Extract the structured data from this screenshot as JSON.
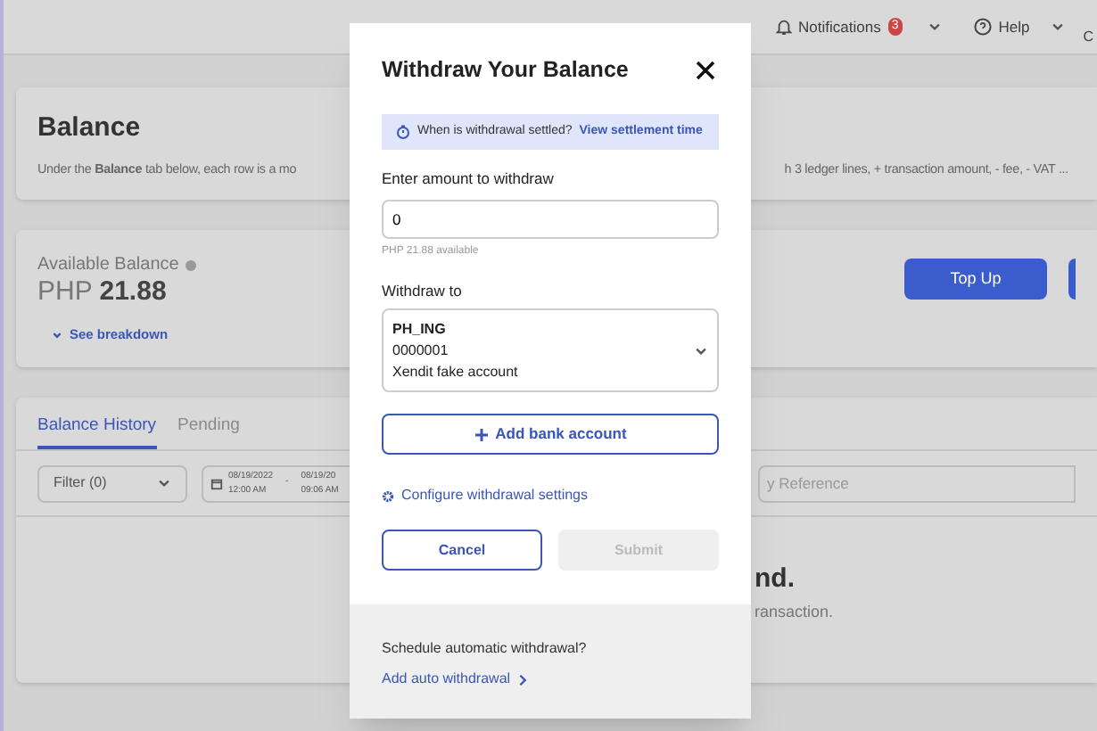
{
  "top_bar": {
    "notifications": {
      "label": "Notifications",
      "count": "3"
    },
    "help": "Help",
    "user_initial": "C"
  },
  "balance_card": {
    "title": "Balance",
    "description_start": "Under the **Balance** tab below, each row is a mo",
    "description_end": "h 3 ledger lines, + transaction amount, - fee, - VAT ..."
  },
  "available_card": {
    "label": "Available Balance",
    "currency": "PHP",
    "amount": "21.88",
    "breakdown_link": "See breakdown",
    "button": "Top Up"
  },
  "history": {
    "tabs": [
      {
        "label": "Balance History",
        "selected": true
      },
      {
        "label": "Pending",
        "selected": false
      }
    ],
    "filter": "Filter (0)",
    "date_from": {
      "date": "08/19/2022",
      "time": "12:00 AM"
    },
    "separator": "-",
    "date_to": {
      "date": "08/19/20",
      "time": "09:06 AM"
    },
    "search_placeholder": "y Reference",
    "empty_title": "nd.",
    "empty_text": "ransaction."
  },
  "modal": {
    "title": "Withdraw Your Balance",
    "info_text": "When is withdrawal settled?",
    "info_link": "View settlement time",
    "amount_label": "Enter amount to withdraw",
    "amount_value": "0",
    "available_hint": "PHP 21.88 available",
    "withdraw_to_label": "Withdraw to",
    "account": [
      "PH_ING",
      "0000001",
      "Xendit fake account"
    ],
    "add_bank": "Add bank account",
    "configure_link": "Configure withdrawal settings",
    "buttons": [
      {
        "label": "Cancel",
        "kind": "secondary",
        "disabled": false
      },
      {
        "label": "Submit",
        "kind": "primary",
        "disabled": true
      }
    ],
    "footer_question": "Schedule automatic withdrawal?",
    "footer_link": "Add auto withdrawal"
  }
}
